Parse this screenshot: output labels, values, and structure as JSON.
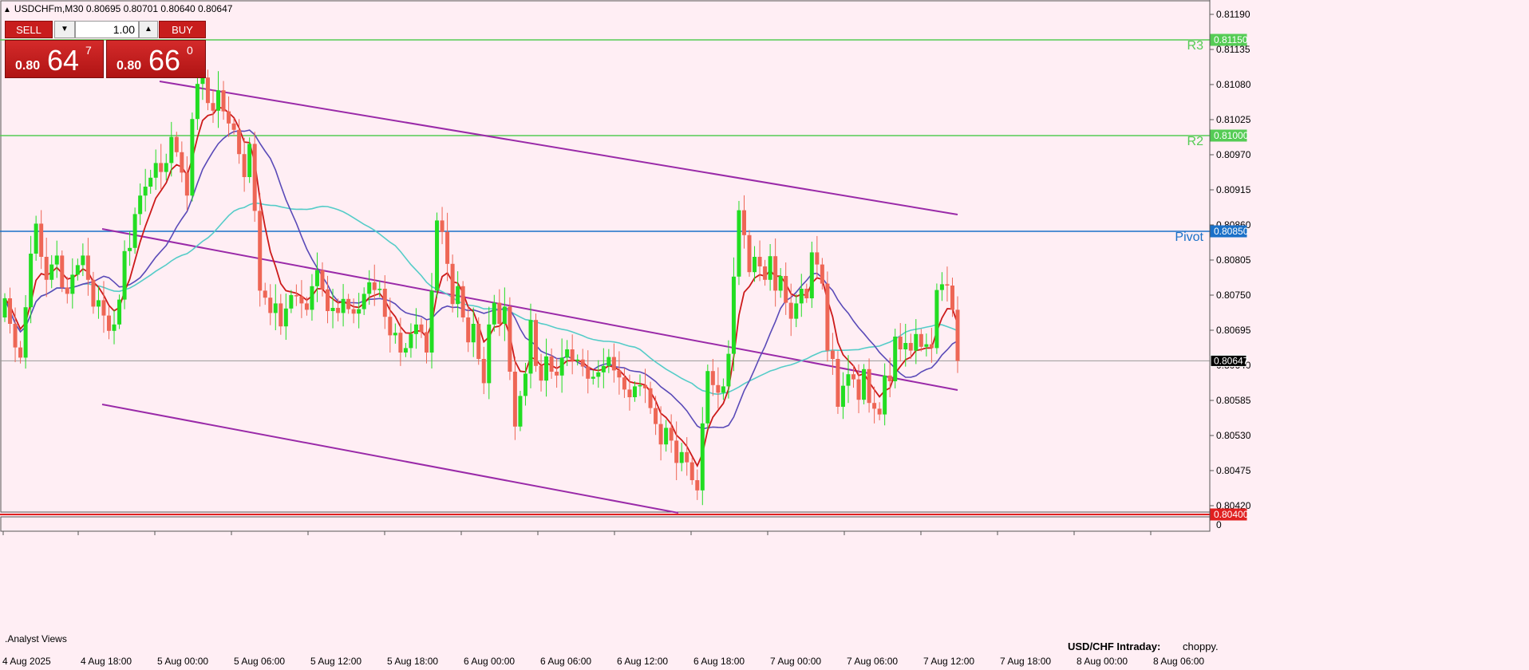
{
  "window": {
    "title": "USDCHFm,M30  0.80695 0.80701 0.80640 0.80647",
    "colors": {
      "background": "#ffeef4",
      "bull_candle": "#22dd22",
      "bear_candle": "#ee6655",
      "ema_fast": "#cc1a1a",
      "ma_mid": "#5a4ab8",
      "ma_slow": "#55ccc8",
      "channel": "#9a2aa8",
      "resistance": "#55cc55",
      "pivot": "#1a70c8",
      "support": "#e02020"
    }
  },
  "trade_panel": {
    "sell_label": "SELL",
    "buy_label": "BUY",
    "lot_value": "1.00",
    "lot_down_icon": "triangle-down-icon",
    "lot_up_icon": "triangle-up-icon",
    "sell_prefix": "0.80",
    "sell_big": "64",
    "sell_sup": "7",
    "buy_prefix": "0.80",
    "buy_big": "66",
    "buy_sup": "0"
  },
  "price_axis": {
    "ticks": [
      "0.81190",
      "0.81135",
      "0.81080",
      "0.81025",
      "0.80970",
      "0.80915",
      "0.80860",
      "0.80805",
      "0.80750",
      "0.80695",
      "0.80640",
      "0.80585",
      "0.80530",
      "0.80475",
      "0.80420"
    ],
    "tags": [
      {
        "name": "R3",
        "value": "0.81150",
        "price": 0.8115,
        "color": "#55cc55"
      },
      {
        "name": "R2",
        "value": "0.81000",
        "price": 0.81,
        "color": "#55cc55"
      },
      {
        "name": "Pivot",
        "value": "0.80850",
        "price": 0.8085,
        "color": "#1a70c8"
      },
      {
        "name": "",
        "value": "0.80647",
        "price": 0.80647,
        "color": "#000000"
      },
      {
        "name": "",
        "value": "0.80400",
        "price": 0.804,
        "color": "#e02020"
      }
    ],
    "indicator_min": "0"
  },
  "time_axis": {
    "labels": [
      "4 Aug 2025",
      "4 Aug 18:00",
      "5 Aug 00:00",
      "5 Aug 06:00",
      "5 Aug 12:00",
      "5 Aug 18:00",
      "6 Aug 00:00",
      "6 Aug 06:00",
      "6 Aug 12:00",
      "6 Aug 18:00",
      "7 Aug 00:00",
      "7 Aug 06:00",
      "7 Aug 12:00",
      "7 Aug 18:00",
      "8 Aug 00:00",
      "8 Aug 06:00"
    ]
  },
  "levels": {
    "r3_label": "R3",
    "r2_label": "R2",
    "pivot_label": "Pivot"
  },
  "footer": {
    "indicator_window": ".Analyst Views",
    "intraday_label": "USD/CHF Intraday:",
    "intraday_value": "choppy."
  },
  "chart_data": {
    "type": "candlestick",
    "symbol": "USDCHFm",
    "timeframe": "M30",
    "ohlc_header": {
      "open": 0.80695,
      "high": 0.80701,
      "low": 0.8064,
      "close": 0.80647
    },
    "ylim": [
      0.804,
      0.8121
    ],
    "closes": [
      0.80745,
      0.80705,
      0.80668,
      0.80652,
      0.80731,
      0.80815,
      0.80862,
      0.8081,
      0.80774,
      0.80798,
      0.80812,
      0.80762,
      0.80752,
      0.80782,
      0.80797,
      0.80812,
      0.80774,
      0.80732,
      0.80742,
      0.80718,
      0.80694,
      0.80704,
      0.80743,
      0.80819,
      0.80824,
      0.80877,
      0.80906,
      0.8092,
      0.80934,
      0.80957,
      0.80943,
      0.80957,
      0.80998,
      0.80974,
      0.80942,
      0.80906,
      0.81026,
      0.81081,
      0.81091,
      0.81051,
      0.81039,
      0.81071,
      0.81038,
      0.81019,
      0.81009,
      0.80971,
      0.80935,
      0.80987,
      0.80882,
      0.80757,
      0.80746,
      0.80722,
      0.80737,
      0.80701,
      0.80729,
      0.8075,
      0.80748,
      0.80737,
      0.80727,
      0.80764,
      0.80789,
      0.80759,
      0.80725,
      0.8073,
      0.80722,
      0.80744,
      0.80728,
      0.80721,
      0.80728,
      0.80752,
      0.8077,
      0.80758,
      0.8076,
      0.80716,
      0.80687,
      0.80691,
      0.8066,
      0.80667,
      0.80689,
      0.80704,
      0.80692,
      0.8066,
      0.80757,
      0.80867,
      0.80849,
      0.80799,
      0.80736,
      0.80764,
      0.80715,
      0.80676,
      0.80705,
      0.8065,
      0.80612,
      0.80704,
      0.80738,
      0.80705,
      0.80732,
      0.8063,
      0.80544,
      0.80592,
      0.80627,
      0.80711,
      0.80639,
      0.80616,
      0.80654,
      0.8063,
      0.80624,
      0.80652,
      0.80665,
      0.80647,
      0.80649,
      0.80638,
      0.80619,
      0.80622,
      0.80629,
      0.80639,
      0.80653,
      0.80632,
      0.80621,
      0.80602,
      0.8059,
      0.80607,
      0.80609,
      0.80604,
      0.80573,
      0.80548,
      0.80516,
      0.80542,
      0.80522,
      0.80487,
      0.80504,
      0.80488,
      0.8046,
      0.80444,
      0.80549,
      0.80631,
      0.80609,
      0.80597,
      0.80607,
      0.80658,
      0.80779,
      0.80883,
      0.80844,
      0.80786,
      0.8081,
      0.80795,
      0.80774,
      0.80811,
      0.80757,
      0.8078,
      0.80738,
      0.80713,
      0.80737,
      0.8076,
      0.80745,
      0.80817,
      0.80798,
      0.80768,
      0.80663,
      0.8065,
      0.80575,
      0.80608,
      0.80626,
      0.80618,
      0.80586,
      0.80634,
      0.80581,
      0.80572,
      0.80563,
      0.80624,
      0.80615,
      0.80685,
      0.80665,
      0.80675,
      0.80663,
      0.80689,
      0.80669,
      0.80673,
      0.80667,
      0.80758,
      0.80767,
      0.80765,
      0.80727,
      0.80647
    ]
  }
}
